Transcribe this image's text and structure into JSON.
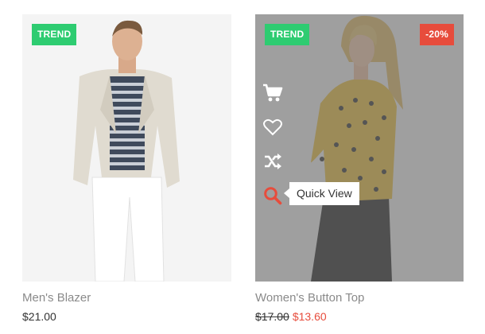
{
  "products": [
    {
      "name": "Men's Blazer",
      "price": "$21.00",
      "badge": "TREND"
    },
    {
      "name": "Women's Button Top",
      "old_price": "$17.00",
      "sale_price": "$13.60",
      "badge": "TREND",
      "discount": "-20%",
      "tooltip": "Quick View",
      "actions": [
        "cart-icon",
        "heart-icon",
        "shuffle-icon",
        "search-icon"
      ]
    }
  ],
  "colors": {
    "trend": "#2ecc71",
    "sale": "#e74c3c",
    "overlay": "#707070",
    "text_muted": "#8a8a8a",
    "text": "#333333"
  }
}
